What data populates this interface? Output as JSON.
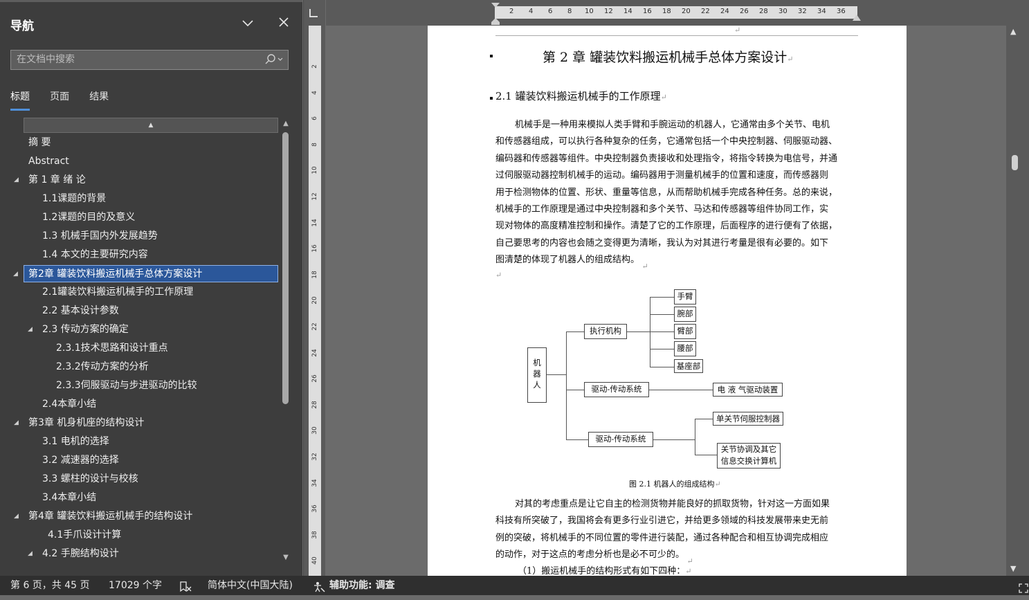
{
  "nav": {
    "title": "导航",
    "search_placeholder": "在文档中搜索",
    "tabs": [
      "标题",
      "页面",
      "结果"
    ],
    "items": [
      {
        "label": "摘  要",
        "level": 1,
        "expand": false
      },
      {
        "label": "Abstract",
        "level": 1,
        "expand": false
      },
      {
        "label": "第 1 章 绪  论",
        "level": 1,
        "expand": true
      },
      {
        "label": "1.1课题的背景",
        "level": 2,
        "expand": false
      },
      {
        "label": "1.2课题的目的及意义",
        "level": 2,
        "expand": false
      },
      {
        "label": "1.3 机械手国内外发展趋势",
        "level": 2,
        "expand": false
      },
      {
        "label": "1.4  本文的主要研究内容",
        "level": 2,
        "expand": false
      },
      {
        "label": "第2章 罐装饮料搬运机械手总体方案设计",
        "level": 1,
        "expand": true,
        "selected": true
      },
      {
        "label": "2.1罐装饮料搬运机械手的工作原理",
        "level": 2,
        "expand": false
      },
      {
        "label": "2.2  基本设计参数",
        "level": 2,
        "expand": false
      },
      {
        "label": "2.3  传动方案的确定",
        "level": 2,
        "expand": true
      },
      {
        "label": "2.3.1技术思路和设计重点",
        "level": 3,
        "expand": false
      },
      {
        "label": "2.3.2传动方案的分析",
        "level": 3,
        "expand": false
      },
      {
        "label": "2.3.3伺服驱动与步进驱动的比较",
        "level": 3,
        "expand": false
      },
      {
        "label": "2.4本章小结",
        "level": 2,
        "expand": false
      },
      {
        "label": "第3章  机身机座的结构设计",
        "level": 1,
        "expand": true
      },
      {
        "label": "3.1  电机的选择",
        "level": 2,
        "expand": false
      },
      {
        "label": "3.2 减速器的选择",
        "level": 2,
        "expand": false
      },
      {
        "label": "3.3  螺柱的设计与校核",
        "level": 2,
        "expand": false
      },
      {
        "label": "3.4本章小结",
        "level": 2,
        "expand": false
      },
      {
        "label": "第4章  罐装饮料搬运机械手的结构设计",
        "level": 1,
        "expand": true
      },
      {
        "label": "4.1手爪设计计算",
        "level": 2.4,
        "expand": false
      },
      {
        "label": "4.2  手腕结构设计",
        "level": 2,
        "expand": true
      }
    ]
  },
  "ruler": {
    "h_ticks": [
      "2",
      "4",
      "6",
      "8",
      "10",
      "12",
      "14",
      "16",
      "18",
      "20",
      "22",
      "24",
      "26",
      "28",
      "30",
      "32",
      "34",
      "36"
    ],
    "v_ticks": [
      "2",
      "4",
      "6",
      "8",
      "10",
      "12",
      "14",
      "16",
      "18",
      "20",
      "22",
      "24",
      "26",
      "28",
      "30",
      "32",
      "34",
      "36",
      "38",
      "40"
    ]
  },
  "doc": {
    "heading1": "第 2 章  罐装饮料搬运机械手总体方案设计",
    "heading2": "2.1 罐装饮料搬运机械手的工作原理",
    "para1_lines": [
      "机械手是一种用来模拟人类手臂和手腕运动的机器人，它通常由多个关节、电机",
      "和传感器组成，可以执行各种复杂的任务，它通常包括一个中央控制器、伺服驱动器、",
      "编码器和传感器等组件。中央控制器负责接收和处理指令，将指令转换为电信号，并通",
      "过伺服驱动器控制机械手的运动。编码器用于测量机械手的位置和速度，而传感器则",
      "用于检测物体的位置、形状、重量等信息，从而帮助机械手完成各种任务。总的来说，",
      "机械手的工作原理是通过中央控制器和多个关节、马达和传感器等组件协同工作，实",
      "现对物体的高度精准控制和操作。清楚了它的工作原理，后面程序的进行便有了依据，",
      "自己要思考的内容也会随之变得更为清晰，我认为对其进行考量是很有必要的。如下",
      "图清楚的体现了机器人的组成结构。"
    ],
    "diagram": {
      "root": "机器人",
      "exec": "执行机构",
      "exec_parts": [
        "手臂",
        "腕部",
        "臂部",
        "腰部",
        "基座部"
      ],
      "drive1": "驱动-传动系统",
      "drive1_target": "电 液 气驱动装置",
      "drive2": "驱动-传动系统",
      "drive2_targets": [
        "单关节伺服控制器",
        "关节协调及其它",
        "信息交换计算机"
      ]
    },
    "caption": "图 2.1  机器人的组成结构",
    "para2_lines": [
      "对其的考虑重点是让它自主的检测货物并能良好的抓取货物，针对这一方面如果",
      "科技有所突破了，我国将会有更多行业引进它，并给更多领域的科技发展带来史无前",
      "例的突破，将机械手的不同位置的零件进行装配，通过各种配合和相互协调完成相应",
      "的动作，对于这点的考虑分析也是必不可少的。"
    ],
    "para3": "（1）搬运机械手的结构形式有如下四种："
  },
  "status": {
    "page": "第 6 页，共 45 页",
    "words": "17029 个字",
    "language": "简体中文(中国大陆)",
    "accessibility": "辅助功能: 调查"
  },
  "colors": {
    "nav_bg": "#3d3d3d",
    "selected": "#2b579a",
    "accent": "#4f8fd8"
  }
}
